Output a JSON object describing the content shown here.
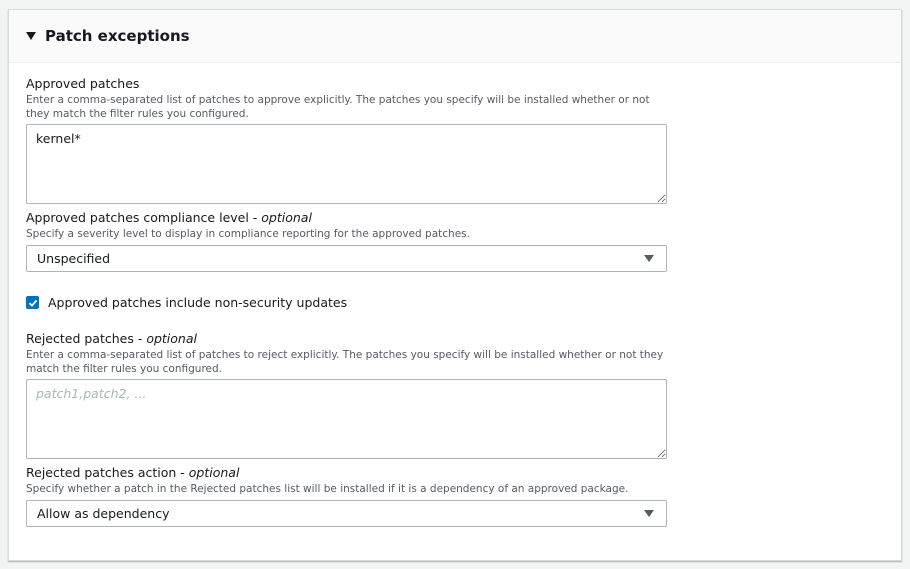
{
  "section": {
    "title": "Patch exceptions"
  },
  "approved_patches": {
    "label": "Approved patches",
    "description": "Enter a comma-separated list of patches to approve explicitly. The patches you specify will be installed whether or not they match the filter rules you configured.",
    "value": "kernel*"
  },
  "compliance_level": {
    "label": "Approved patches compliance level - ",
    "optional": "optional",
    "description": "Specify a severity level to display in compliance reporting for the approved patches.",
    "selected": "Unspecified"
  },
  "non_security": {
    "label": "Approved patches include non-security updates",
    "checked": true
  },
  "rejected_patches": {
    "label": "Rejected patches - ",
    "optional": "optional",
    "description": "Enter a comma-separated list of patches to reject explicitly. The patches you specify will be installed whether or not they match the filter rules you configured.",
    "placeholder": "patch1,patch2, ...",
    "value": ""
  },
  "rejected_action": {
    "label": "Rejected patches action - ",
    "optional": "optional",
    "description": "Specify whether a patch in the Rejected patches list will be installed if it is a dependency of an approved package.",
    "selected": "Allow as dependency"
  },
  "colors": {
    "accent": "#0073bb",
    "border": "#aab7b8",
    "muted": "#545b64"
  }
}
